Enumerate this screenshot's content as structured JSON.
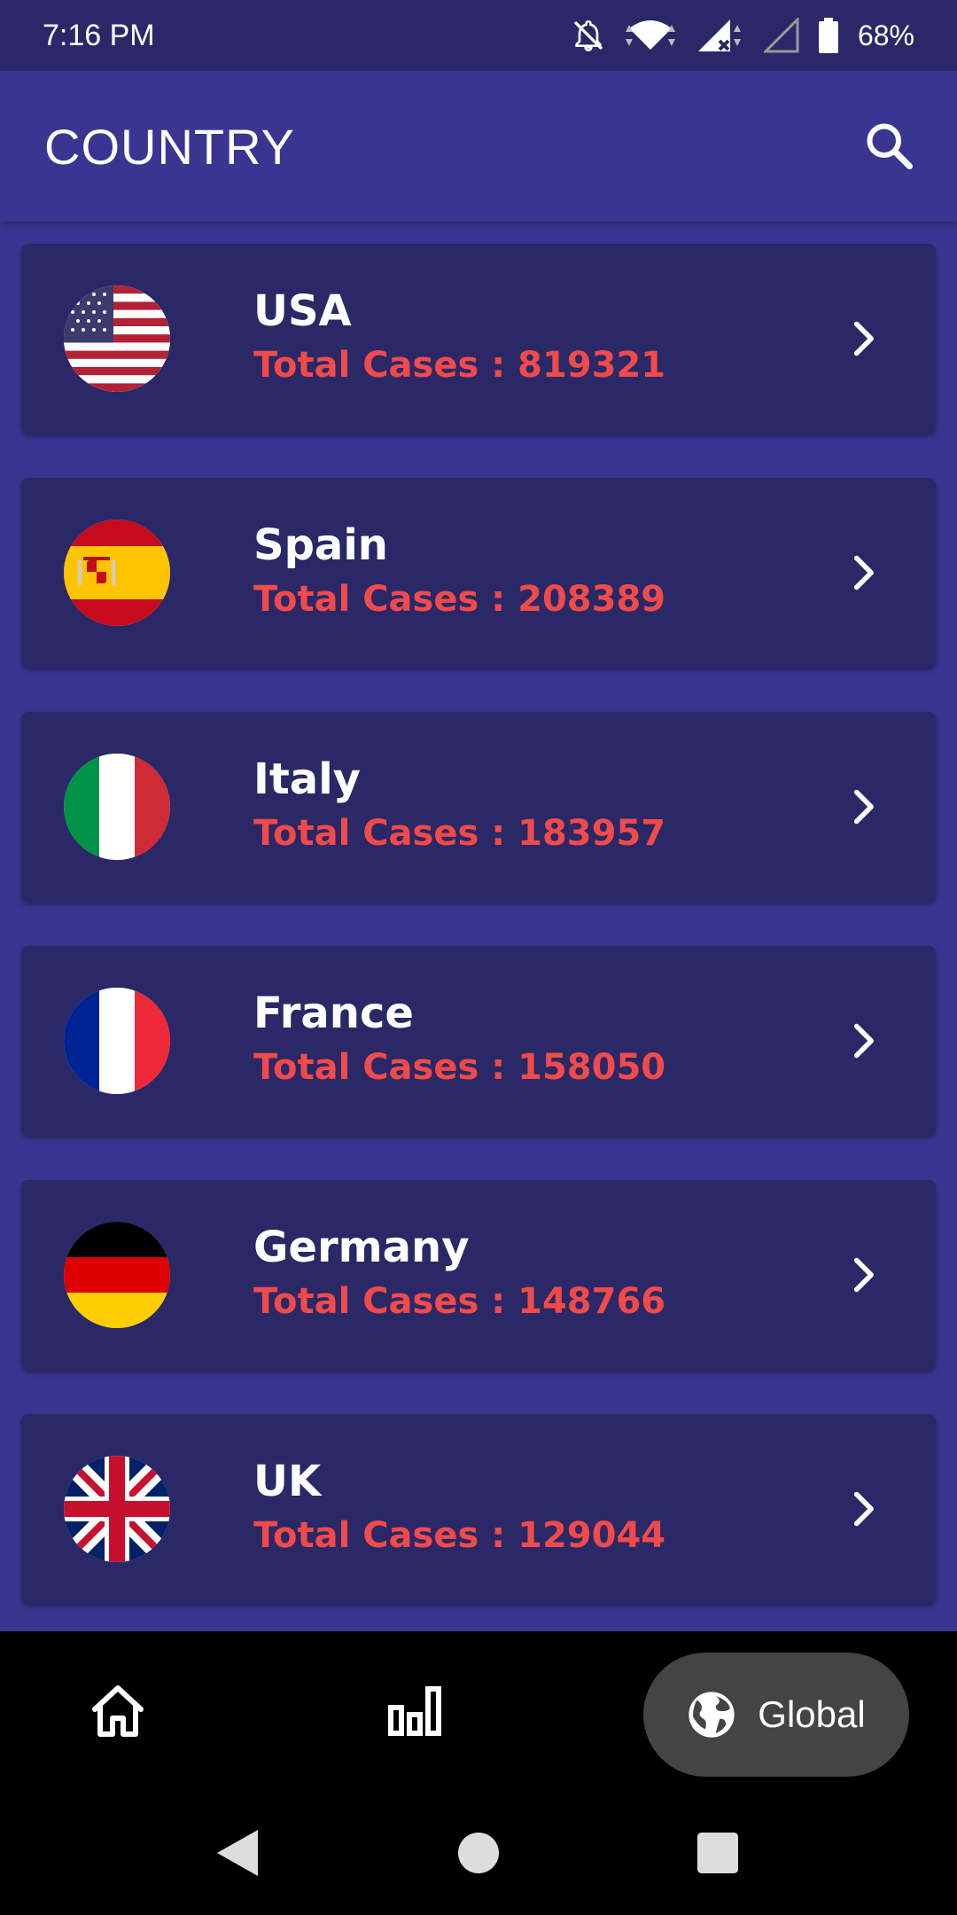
{
  "status_bar": {
    "time": "7:16 PM",
    "battery_percent": "68%",
    "icons": [
      "notifications-off-icon",
      "wifi-icon",
      "signal-icon",
      "signal-empty-icon",
      "battery-icon"
    ]
  },
  "app_bar": {
    "title": "COUNTRY",
    "search_icon": "search-icon"
  },
  "countries": [
    {
      "name": "USA",
      "cases": "Total Cases : 819321",
      "flag": "usa-flag"
    },
    {
      "name": "Spain",
      "cases": "Total Cases : 208389",
      "flag": "spain-flag"
    },
    {
      "name": "Italy",
      "cases": "Total Cases : 183957",
      "flag": "italy-flag"
    },
    {
      "name": "France",
      "cases": "Total Cases : 158050",
      "flag": "france-flag"
    },
    {
      "name": "Germany",
      "cases": "Total Cases : 148766",
      "flag": "germany-flag"
    },
    {
      "name": "UK",
      "cases": "Total Cases : 129044",
      "flag": "uk-flag"
    }
  ],
  "bottom_nav": {
    "items": [
      {
        "icon": "home-icon"
      },
      {
        "icon": "bar-chart-icon"
      },
      {
        "icon": "globe-icon",
        "label": "Global",
        "selected": true
      }
    ]
  },
  "colors": {
    "background": "#3a3590",
    "card": "#2a2866",
    "accent_red": "#f04a4a",
    "status_bar": "#2a2868"
  }
}
